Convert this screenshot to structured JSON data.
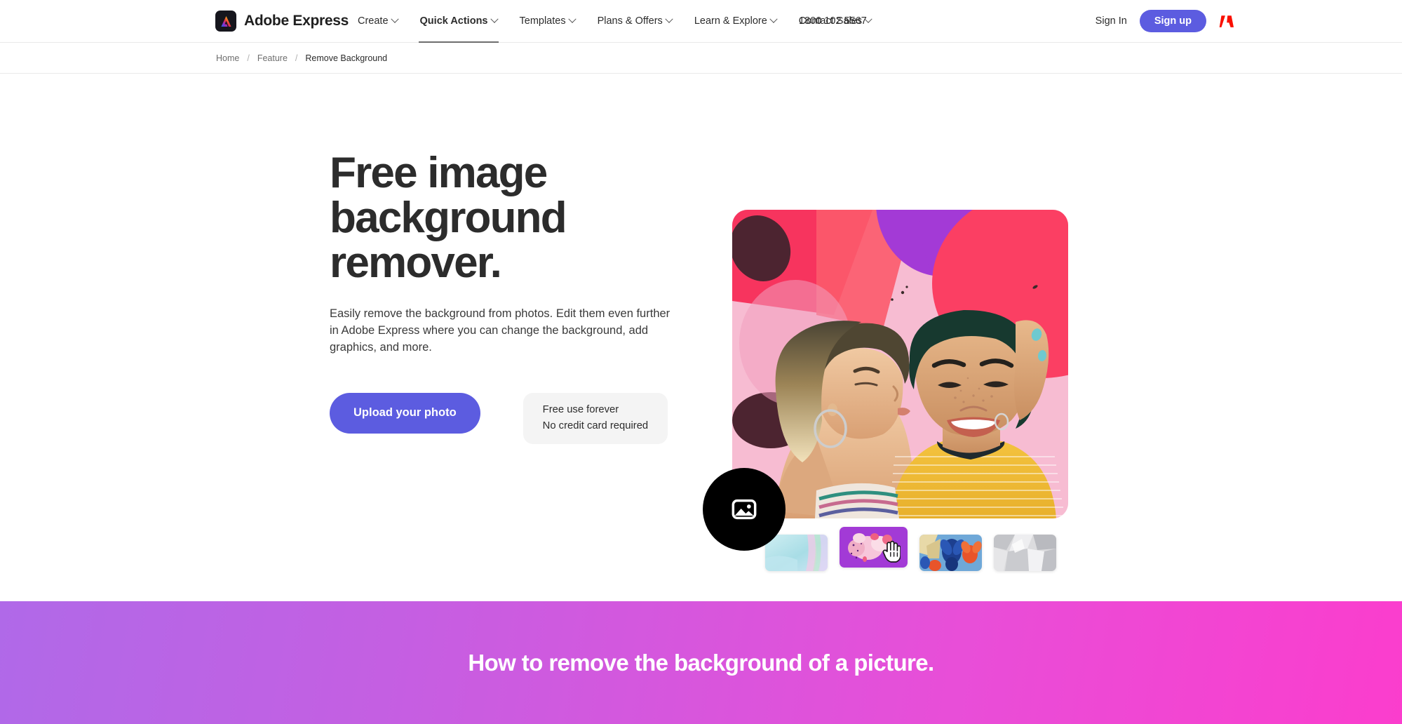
{
  "header": {
    "brand": {
      "name": "Adobe Express",
      "logo_icon": "adobe-express-logo-icon"
    },
    "nav": [
      {
        "label": "Create",
        "has_caret": true,
        "active": false
      },
      {
        "label": "Quick Actions",
        "has_caret": true,
        "active": true
      },
      {
        "label": "Templates",
        "has_caret": true,
        "active": false
      },
      {
        "label": "Plans & Offers",
        "has_caret": true,
        "active": false
      },
      {
        "label": "Learn & Explore",
        "has_caret": true,
        "active": false
      },
      {
        "label": "Contact Sales",
        "has_caret": true,
        "active": false
      }
    ],
    "phone": "1800 102 5567",
    "sign_in": "Sign In",
    "sign_up": "Sign up",
    "adobe_icon": "adobe-logo-icon",
    "accent_color": "#5c5ce0"
  },
  "breadcrumb": {
    "items": [
      "Home",
      "Feature",
      "Remove Background"
    ],
    "separator": "/"
  },
  "hero": {
    "title": "Free image background remover.",
    "title_lines": [
      "Free image",
      "background",
      "remover."
    ],
    "subtitle": "Easily remove the background from photos. Edit them even further in Adobe Express where you can change the background, add graphics, and more.",
    "upload_button": "Upload your photo",
    "free_card": {
      "line1": "Free use forever",
      "line2": "No credit card required"
    },
    "photo_alt": "Two women embracing in front of a pink and purple mural",
    "badge_icon": "image-icon",
    "thumbnails": [
      {
        "name": "iridescent-teal-thumbnail",
        "selected": false
      },
      {
        "name": "purple-blob-thumbnail",
        "selected": true
      },
      {
        "name": "blue-floral-thumbnail",
        "selected": false
      },
      {
        "name": "silver-crystal-thumbnail",
        "selected": false
      }
    ],
    "cursor_icon": "hand-pointer-cursor"
  },
  "promo": {
    "title": "How to remove the background of a picture.",
    "gradient_from": "#b069e8",
    "gradient_to": "#fb3dcd"
  }
}
